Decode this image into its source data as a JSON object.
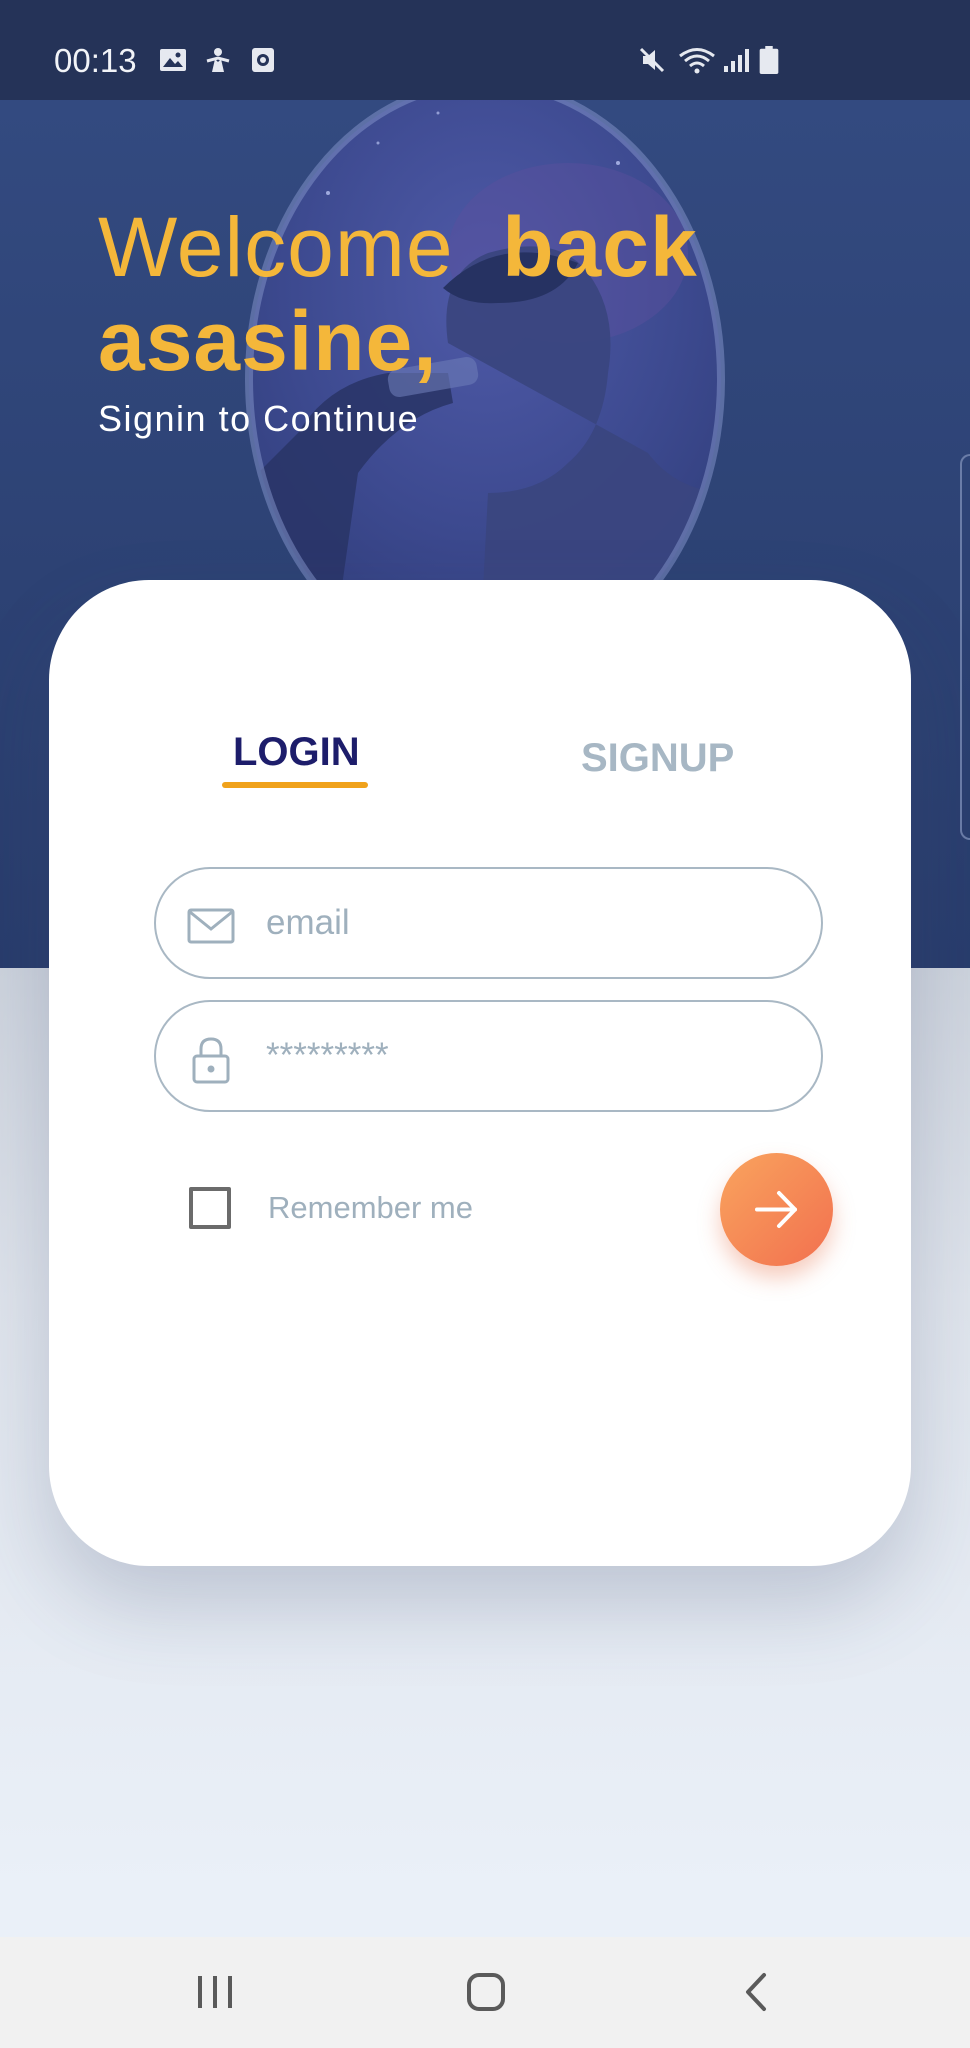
{
  "status_bar": {
    "time": "00:13",
    "left_icons": [
      "gallery-icon",
      "accessibility-icon",
      "screen-recorder-icon"
    ],
    "right_icons": [
      "mute-icon",
      "wifi-icon",
      "signal-icon",
      "battery-icon"
    ]
  },
  "hero": {
    "welcome_regular": "Welcome",
    "welcome_bold": "back",
    "username": "asasine,",
    "subtitle": "Signin to Continue",
    "accent_color": "#f4b73a",
    "background_color": "#2d4274"
  },
  "auth_card": {
    "tabs": [
      {
        "label": "LOGIN",
        "active": true
      },
      {
        "label": "SIGNUP",
        "active": false
      }
    ],
    "email": {
      "placeholder": "email",
      "value": ""
    },
    "password": {
      "placeholder": "*********",
      "value": ""
    },
    "remember_label": "Remember me",
    "remember_checked": false,
    "submit_icon": "arrow-right-icon"
  },
  "nav_bar": {
    "buttons": [
      "recent-apps-icon",
      "home-icon",
      "back-icon"
    ]
  }
}
